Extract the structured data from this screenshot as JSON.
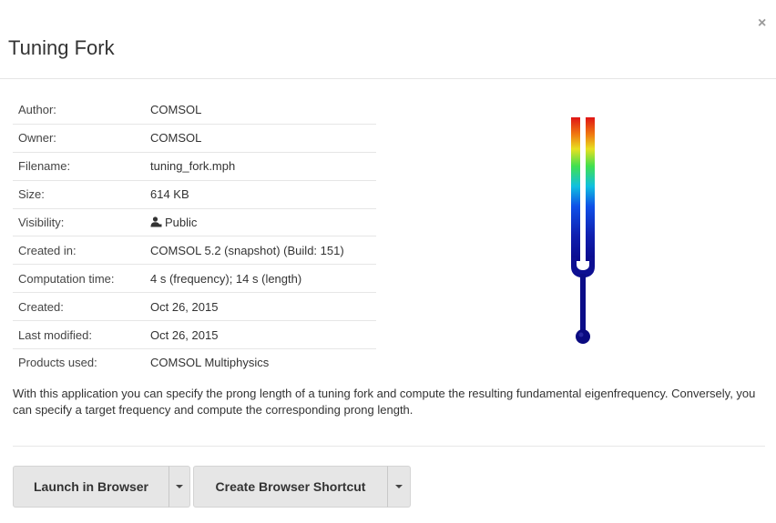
{
  "dialog": {
    "title": "Tuning Fork",
    "close_label": "×"
  },
  "details": [
    {
      "key": "Author:",
      "value": "COMSOL"
    },
    {
      "key": "Owner:",
      "value": "COMSOL"
    },
    {
      "key": "Filename:",
      "value": "tuning_fork.mph"
    },
    {
      "key": "Size:",
      "value": "614 KB"
    },
    {
      "key": "Visibility:",
      "value": "Public",
      "icon": "user-icon"
    },
    {
      "key": "Created in:",
      "value": "COMSOL 5.2 (snapshot) (Build: 151)"
    },
    {
      "key": "Computation time:",
      "value": "4 s (frequency); 14 s (length)"
    },
    {
      "key": "Created:",
      "value": "Oct 26, 2015"
    },
    {
      "key": "Last modified:",
      "value": "Oct 26, 2015"
    },
    {
      "key": "Products used:",
      "value": "COMSOL Multiphysics"
    }
  ],
  "description": "With this application you can specify the prong length of a tuning fork and compute the resulting fundamental eigenfrequency. Conversely, you can specify a target frequency and compute the corresponding prong length.",
  "actions": {
    "launch_label": "Launch in Browser",
    "shortcut_label": "Create Browser Shortcut"
  },
  "colors": {
    "button_bg": "#e6e6e6",
    "fork_low": "#0a0a8c",
    "fork_high": "#e01010"
  }
}
